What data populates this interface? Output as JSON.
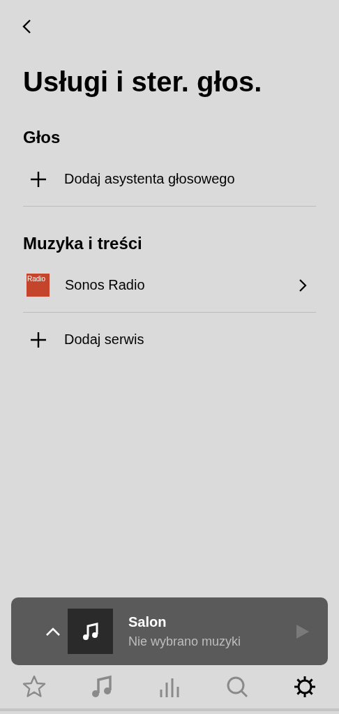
{
  "header": {
    "title": "Usługi i ster. głos."
  },
  "sections": [
    {
      "title": "Głos",
      "items": [
        {
          "kind": "add",
          "label": "Dodaj asystenta głosowego"
        }
      ]
    },
    {
      "title": "Muzyka i treści",
      "items": [
        {
          "kind": "service",
          "label": "Sonos Radio",
          "logo_text": "Radio"
        },
        {
          "kind": "add",
          "label": "Dodaj serwis"
        }
      ]
    }
  ],
  "player": {
    "room": "Salon",
    "status": "Nie wybrano muzyki"
  },
  "tabs": [
    {
      "kind": "favorites",
      "selected": false
    },
    {
      "kind": "music",
      "selected": false
    },
    {
      "kind": "rooms",
      "selected": false
    },
    {
      "kind": "search",
      "selected": false
    },
    {
      "kind": "settings",
      "selected": true
    }
  ]
}
